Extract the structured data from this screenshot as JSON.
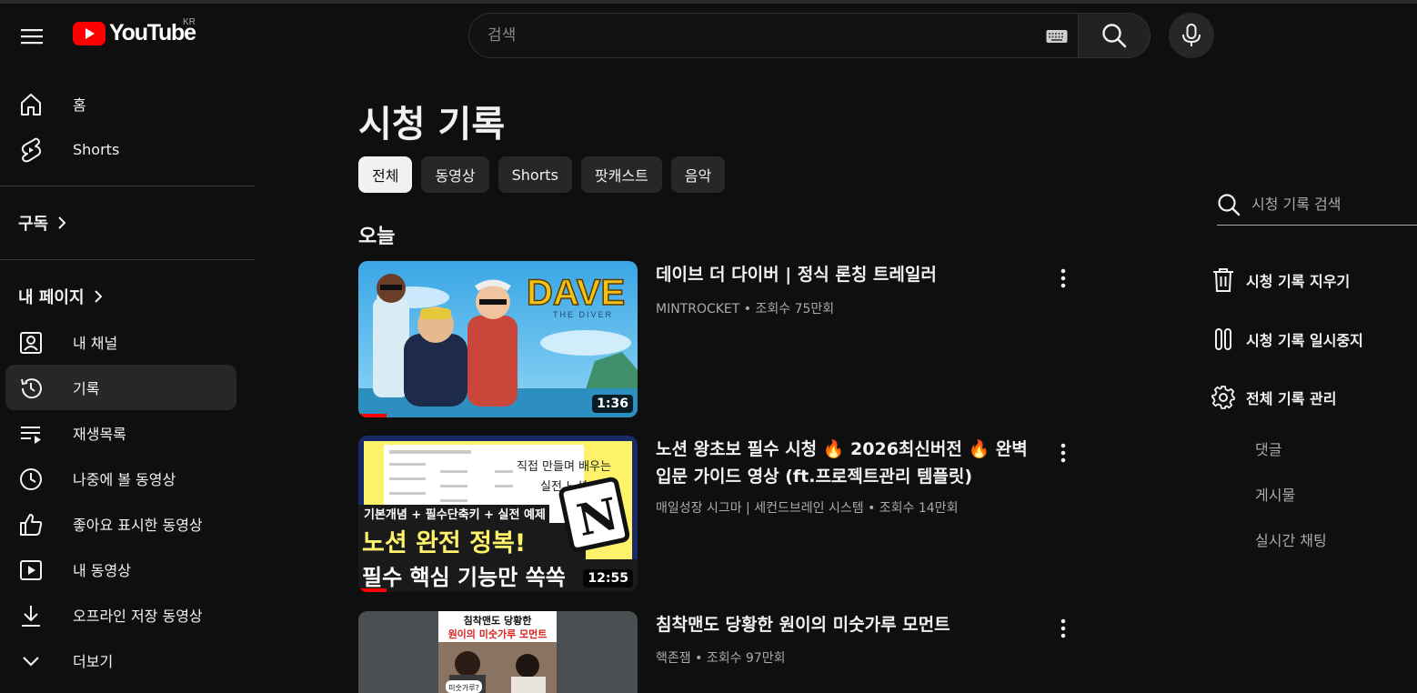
{
  "header": {
    "logo_text": "YouTube",
    "region": "KR",
    "search_placeholder": "검색"
  },
  "sidebar": {
    "top_items": [
      {
        "label": "홈",
        "icon": "home-icon"
      },
      {
        "label": "Shorts",
        "icon": "shorts-icon"
      }
    ],
    "subscriptions_label": "구독",
    "my_page_label": "내 페이지",
    "my_items": [
      {
        "label": "내 채널",
        "icon": "channel-icon"
      },
      {
        "label": "기록",
        "icon": "history-icon",
        "active": true
      },
      {
        "label": "재생목록",
        "icon": "playlist-icon"
      },
      {
        "label": "나중에 볼 동영상",
        "icon": "watch-later-icon"
      },
      {
        "label": "좋아요 표시한 동영상",
        "icon": "like-icon"
      },
      {
        "label": "내 동영상",
        "icon": "my-videos-icon"
      },
      {
        "label": "오프라인 저장 동영상",
        "icon": "download-icon"
      },
      {
        "label": "더보기",
        "icon": "chevron-down-icon"
      }
    ]
  },
  "main": {
    "title": "시청 기록",
    "chips": [
      "전체",
      "동영상",
      "Shorts",
      "팟캐스트",
      "음악"
    ],
    "active_chip": "전체",
    "day_label": "오늘",
    "videos": [
      {
        "title": "데이브 더 다이버 | 정식 론칭 트레일러",
        "channel": "MINTROCKET",
        "views": "조회수 75만회",
        "duration": "1:36",
        "progress": 0.1
      },
      {
        "title": "노션 왕초보 필수 시청 🔥 2026최신버전 🔥 완벽 입문 가이드 영상 (ft.프로젝트관리 템플릿)",
        "channel": "매일성장 시그마 | 세컨드브레인 시스템",
        "views": "조회수 14만회",
        "duration": "12:55",
        "progress": 0.1
      },
      {
        "title": "침착맨도 당황한 원이의 미숫가루 모먼트",
        "channel": "핵존잼",
        "views": "조회수 97만회",
        "duration": "",
        "progress": 0
      }
    ],
    "thumb_texts": {
      "dave_logo": "DAVE",
      "dave_sub": "THE DIVER",
      "notion_handwriting_1": "직접 만들며 배우는",
      "notion_handwriting_2": "실전 노션",
      "notion_band": "기본개념 + 필수단축키 + 실전 예제",
      "notion_big_1": "노션 완전 정복!",
      "notion_big_2": "필수 핵심 기능만 쏙쏙",
      "notion_logo": "N",
      "third_title_1": "침착맨도 당황한",
      "third_title_2": "원이의 미숫가루 모먼트",
      "third_bubble": "미숫가루?"
    }
  },
  "right_panel": {
    "search_placeholder": "시청 기록 검색",
    "actions": [
      {
        "label": "시청 기록 지우기",
        "icon": "trash-icon"
      },
      {
        "label": "시청 기록 일시중지",
        "icon": "pause-icon"
      },
      {
        "label": "전체 기록 관리",
        "icon": "gear-icon"
      }
    ],
    "sub_items": [
      "댓글",
      "게시물",
      "실시간 채팅"
    ]
  },
  "colors": {
    "background": "#0f0f0f",
    "brand_red": "#ff0000",
    "chip_bg": "#272727",
    "chip_active_bg": "#f1f1f1",
    "meta_text": "#aaaaaa"
  }
}
